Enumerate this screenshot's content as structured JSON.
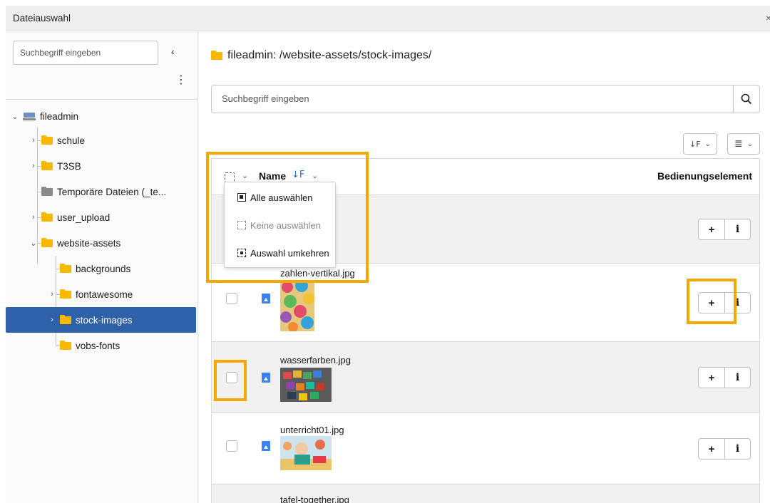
{
  "window": {
    "title": "Dateiauswahl",
    "close_glyph": "×"
  },
  "sidebar": {
    "search_placeholder": "Suchbegriff eingeben",
    "collapse_glyph": "‹",
    "menu_glyph": "⋮",
    "tree": {
      "root": "fileadmin",
      "items": {
        "schule": "schule",
        "t3sb": "T3SB",
        "temp": "Temporäre Dateien (_te...",
        "user_upload": "user_upload",
        "website_assets": "website-assets",
        "backgrounds": "backgrounds",
        "fontawesome": "fontawesome",
        "stock_images": "stock-images",
        "vobs_fonts": "vobs-fonts"
      }
    }
  },
  "main": {
    "path": "fileadmin: /website-assets/stock-images/",
    "search_placeholder": "Suchbegriff eingeben",
    "sort_glyph": "↓F",
    "view_glyph": "≣",
    "table": {
      "col_name": "Name",
      "col_actions": "Bedienungselement",
      "rows": [
        {
          "name": "zahlen-vertikal.jpg",
          "checked": false
        },
        {
          "name": "wasserfarben.jpg",
          "checked": false
        },
        {
          "name": "unterricht01.jpg",
          "checked": false
        },
        {
          "name": "tafel-together.jpg",
          "checked": false
        }
      ],
      "add_glyph": "+",
      "info_glyph": "i"
    },
    "selection_menu": {
      "select_all": "Alle auswählen",
      "select_none": "Keine auswählen",
      "invert": "Auswahl umkehren"
    }
  },
  "colors": {
    "accent": "#2f60aa",
    "folder": "#f6b900",
    "highlight": "#f5a800"
  },
  "icons": [
    "folder-icon",
    "drive-icon",
    "search-icon",
    "image-file-icon",
    "chevron-down-icon",
    "chevron-right-icon"
  ]
}
